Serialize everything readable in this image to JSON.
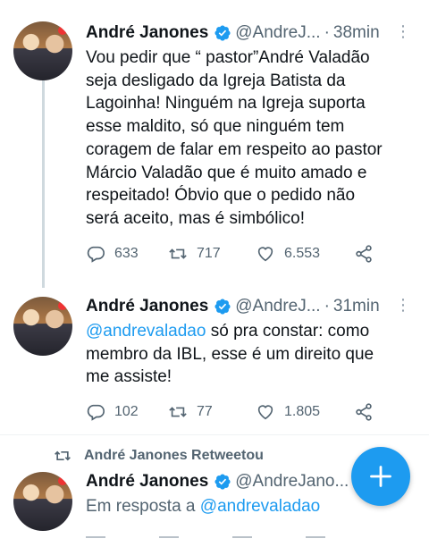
{
  "colors": {
    "accent": "#1d9bf0",
    "text": "#0f1419",
    "secondary": "#536471",
    "divider": "#eff3f4"
  },
  "tweets": [
    {
      "name": "André Janones",
      "handle": "@AndreJ...",
      "time": "38min",
      "text": "Vou pedir que “ pastor”André Valadão\nseja desligado da Igreja Batista da\nLagoinha! Ninguém na Igreja suporta\nesse maldito, só que ninguém tem\ncoragem de falar em respeito ao pastor\nMárcio Valadão que é muito amado e\nrespeitado! Óbvio que o pedido não\nserá aceito, mas é simbólico!",
      "replies": "633",
      "retweets": "717",
      "likes": "6.553"
    },
    {
      "name": "André Janones",
      "handle": "@AndreJ...",
      "time": "31min",
      "mention": "@andrevaladao",
      "text": " só pra constar: como\nmembro da IBL, esse é um direito que\nme assiste!",
      "replies": "102",
      "retweets": "77",
      "likes": "1.805"
    },
    {
      "retweeted_label": "André Janones Retweetou",
      "name": "André Janones",
      "handle": "@AndreJano...",
      "reply_prefix": "Em resposta a ",
      "reply_to": "@andrevaladao"
    }
  ],
  "icons": {
    "verified": "verified-badge-icon",
    "more": "more-vertical-icon",
    "reply": "reply-icon",
    "retweet": "retweet-icon",
    "like": "heart-icon",
    "share": "share-icon",
    "compose": "plus-icon"
  }
}
